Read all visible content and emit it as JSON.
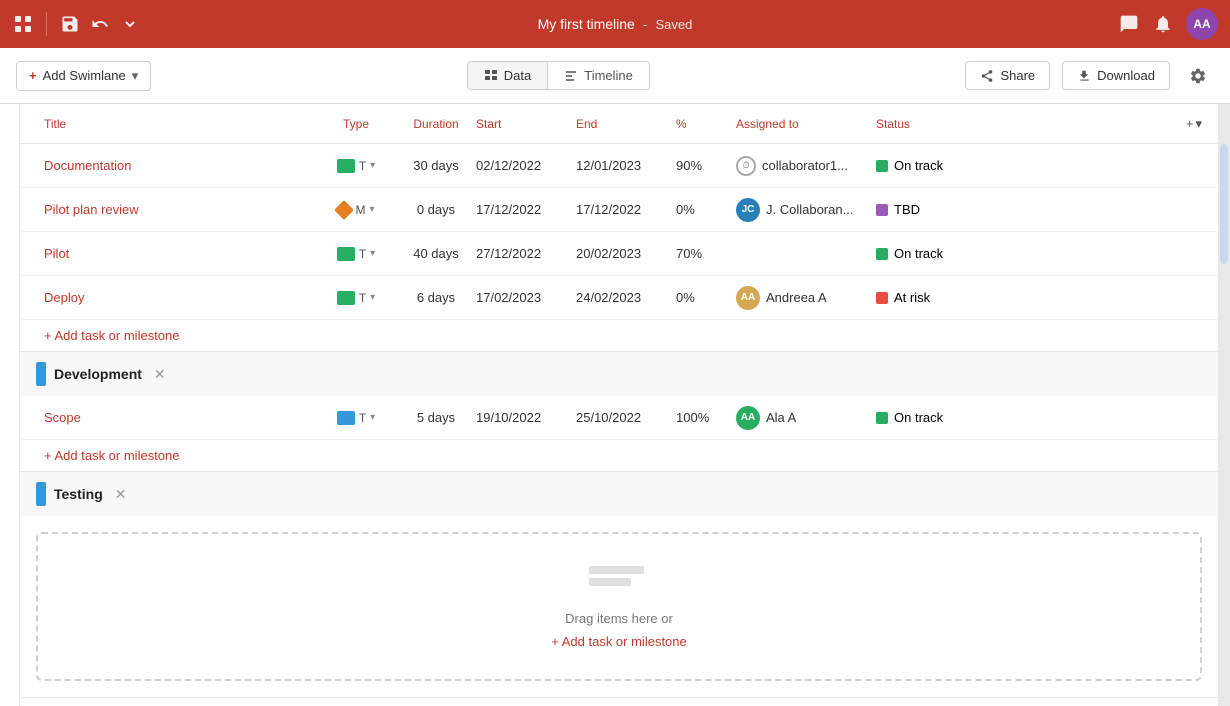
{
  "app": {
    "title": "My first timeline",
    "saved_label": "Saved",
    "avatar": "AA"
  },
  "toolbar": {
    "add_swimlane": "Add Swimlane",
    "tab_data": "Data",
    "tab_timeline": "Timeline",
    "share": "Share",
    "download": "Download"
  },
  "table": {
    "columns": {
      "title": "Title",
      "type": "Type",
      "duration": "Duration",
      "start": "Start",
      "end": "End",
      "pct": "%",
      "assigned": "Assigned to",
      "status": "Status"
    }
  },
  "swimlanes": [
    {
      "name": "",
      "color": "#e8e8e8",
      "tasks": [
        {
          "title": "Documentation",
          "type": "T",
          "type_color": "#27ae60",
          "duration": "30 days",
          "start": "02/12/2022",
          "end": "12/01/2023",
          "pct": "90%",
          "assigned_type": "clock",
          "assigned_name": "collaborator1...",
          "status": "On track",
          "status_color": "#27ae60"
        },
        {
          "title": "Pilot plan review",
          "type": "M",
          "type_color": "#e67e22",
          "type_shape": "diamond",
          "duration": "0 days",
          "start": "17/12/2022",
          "end": "17/12/2022",
          "pct": "0%",
          "assigned_type": "avatar",
          "assigned_color": "#2980b9",
          "assigned_initials": "JC",
          "assigned_name": "J. Collaboran...",
          "status": "TBD",
          "status_color": "#9b59b6"
        },
        {
          "title": "Pilot",
          "type": "T",
          "type_color": "#27ae60",
          "duration": "40 days",
          "start": "27/12/2022",
          "end": "20/02/2023",
          "pct": "70%",
          "assigned_type": "none",
          "assigned_name": "",
          "status": "On track",
          "status_color": "#27ae60"
        },
        {
          "title": "Deploy",
          "type": "T",
          "type_color": "#27ae60",
          "duration": "6 days",
          "start": "17/02/2023",
          "end": "24/02/2023",
          "pct": "0%",
          "assigned_type": "avatar",
          "assigned_color": "#d4a853",
          "assigned_initials": "AA",
          "assigned_name": "Andreea A",
          "status": "At risk",
          "status_color": "#e74c3c"
        }
      ]
    },
    {
      "name": "Development",
      "color": "#3498db",
      "tasks": [
        {
          "title": "Scope",
          "type": "T",
          "type_color": "#3498db",
          "duration": "5 days",
          "start": "19/10/2022",
          "end": "25/10/2022",
          "pct": "100%",
          "assigned_type": "avatar",
          "assigned_color": "#27ae60",
          "assigned_initials": "AA",
          "assigned_name": "Ala A",
          "status": "On track",
          "status_color": "#27ae60"
        }
      ]
    },
    {
      "name": "Testing",
      "color": "#3498db",
      "tasks": []
    }
  ],
  "labels": {
    "add_task": "+ Add task or milestone",
    "drag_text": "Drag items here or",
    "drag_add": "+ Add task or milestone"
  }
}
